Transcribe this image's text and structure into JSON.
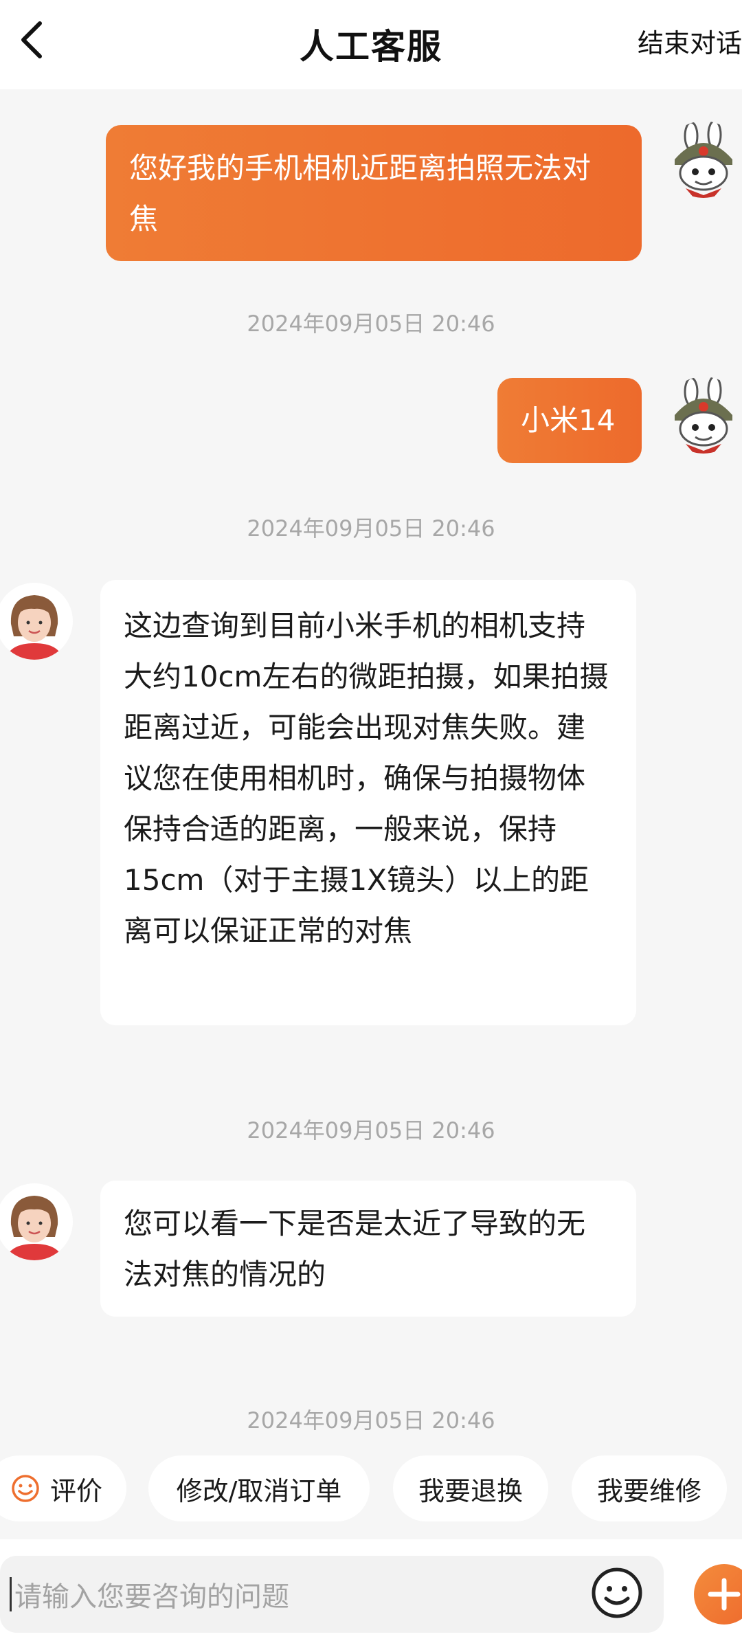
{
  "header": {
    "back_icon": "chevron-left-icon",
    "title": "人工客服",
    "end_chat": "结束对话"
  },
  "messages": [
    {
      "sender": "user",
      "text": "您好我的手机相机近距离拍照无法对焦",
      "time": "2024年09月05日 20:46"
    },
    {
      "sender": "user",
      "text": "小米14",
      "time": "2024年09月05日 20:46"
    },
    {
      "sender": "agent",
      "text": "这边查询到目前小米手机的相机支持大约10cm左右的微距拍摄，如果拍摄距离过近，可能会出现对焦失败。建议您在使用相机时，确保与拍摄物体保持合适的距离，一般来说，保持15cm（对于主摄1X镜头）以上的距离可以保证正常的对焦",
      "time": "2024年09月05日 20:46"
    },
    {
      "sender": "agent",
      "text": "您可以看一下是否是太近了导致的无法对焦的情况的",
      "time": "2024年09月05日 20:46"
    }
  ],
  "quick_actions": [
    {
      "label": "评价",
      "icon": "smiley-icon"
    },
    {
      "label": "修改/取消订单"
    },
    {
      "label": "我要退换"
    },
    {
      "label": "我要维修"
    }
  ],
  "input": {
    "placeholder": "请输入您要咨询的问题",
    "emoji_icon": "emoji-icon",
    "plus_icon": "plus-icon"
  },
  "colors": {
    "accent": "#ee6f2f",
    "background": "#f6f6f6",
    "timestamp": "#a7a7a7"
  }
}
